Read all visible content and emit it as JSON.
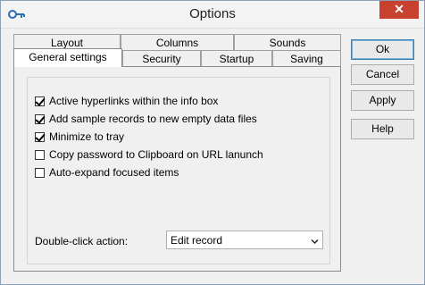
{
  "window": {
    "title": "Options",
    "icons": {
      "app": "key-icon",
      "close": "close-icon"
    }
  },
  "tabs": {
    "row1": [
      {
        "label": "Layout"
      },
      {
        "label": "Columns"
      },
      {
        "label": "Sounds"
      }
    ],
    "row2": [
      {
        "label": "General settings",
        "selected": true
      },
      {
        "label": "Security"
      },
      {
        "label": "Startup"
      },
      {
        "label": "Saving"
      }
    ]
  },
  "general": {
    "checkboxes": [
      {
        "label": "Active hyperlinks within the info box",
        "checked": true
      },
      {
        "label": "Add sample records to new empty data files",
        "checked": true
      },
      {
        "label": "Minimize to tray",
        "checked": true
      },
      {
        "label": "Copy password to Clipboard on URL lanunch",
        "checked": false
      },
      {
        "label": "Auto-expand focused items",
        "checked": false
      }
    ],
    "double_click_label": "Double-click action:",
    "double_click_value": "Edit record"
  },
  "buttons": {
    "ok": "Ok",
    "cancel": "Cancel",
    "apply": "Apply",
    "help": "Help"
  }
}
